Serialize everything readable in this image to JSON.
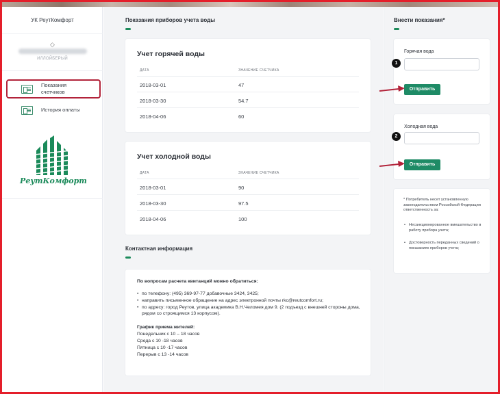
{
  "sidebar": {
    "company": "УК РеутКомфорт",
    "user_mark": "◇",
    "user_role": "ИЛЛОЙБЕРЫЙ",
    "nav": [
      {
        "label_line1": "Показания",
        "label_line2": "счетчиков",
        "active": true
      },
      {
        "label_line1": "История оплаты",
        "label_line2": "",
        "active": false
      }
    ],
    "logo_text": "РеутКомфорт",
    "logo_color": "#1b8a5a"
  },
  "main": {
    "section_meters": "Показания приборов учета воды",
    "hot": {
      "title": "Учет горячей воды",
      "col_date": "ДАТА",
      "col_value": "ЗНАЧЕНИЕ СЧЕТЧИКА",
      "rows": [
        {
          "date": "2018-03-01",
          "value": "47"
        },
        {
          "date": "2018-03-30",
          "value": "54.7"
        },
        {
          "date": "2018-04-06",
          "value": "60"
        }
      ]
    },
    "cold": {
      "title": "Учет холодной воды",
      "col_date": "ДАТА",
      "col_value": "ЗНАЧЕНИЕ СЧЕТЧИКА",
      "rows": [
        {
          "date": "2018-03-01",
          "value": "90"
        },
        {
          "date": "2018-03-30",
          "value": "97.5"
        },
        {
          "date": "2018-04-06",
          "value": "100"
        }
      ]
    },
    "section_contacts": "Контактная информация",
    "contacts": {
      "intro": "По вопросам расчета квитанций можно обратиться:",
      "items": [
        "по телефону: (495) 369-97-77 добавочные 3424, 3425;",
        "направить письменное обращение на адрес электронной почты rkc@reutcomfort.ru;",
        "по адресу: город Реутов, улица академика В.Н.Челомея дом 9. (2 подъезд с внешней стороны дома, рядом со строящимся 13 корпусом)."
      ],
      "schedule_title": "График приема жителей:",
      "schedule": [
        "Понедельник с 10 – 18 часов",
        "Среда с 10 -18 часов",
        "Пятница с 10 -17 часов",
        "Перерыв с 13 -14 часов"
      ]
    }
  },
  "right": {
    "title": "Внести показания*",
    "hot_label": "Горячая вода",
    "cold_label": "Холодная вода",
    "hot_value": "",
    "cold_value": "",
    "submit_label": "Отправить",
    "badge1": "1",
    "badge2": "2",
    "note_star": "*",
    "note_text": "Потребитель несет установленную законодательством Российской Федерации ответственность за:",
    "note_items": [
      "Несанкционированное вмешательство в работу прибора учета;",
      "Достоверность переданных сведений о показаниях приборов учета;"
    ],
    "accent_color": "#1e8b66",
    "annotation_color": "#b2233a"
  }
}
